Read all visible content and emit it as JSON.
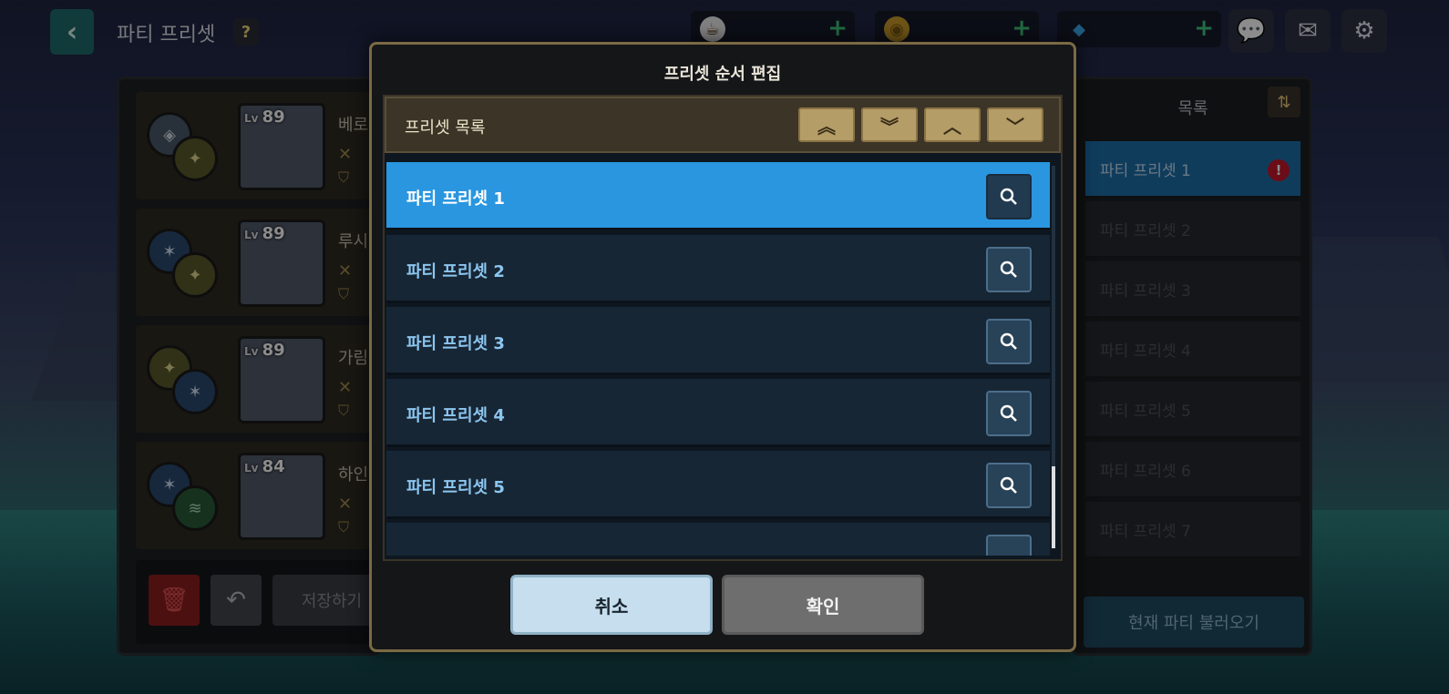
{
  "header": {
    "title": "파티 프리셋",
    "help_label": "?"
  },
  "currencies": [
    {
      "icon": "coffee-icon",
      "value": ""
    },
    {
      "icon": "gold-coin-icon",
      "value": ""
    },
    {
      "icon": "diamond-icon",
      "value": ""
    }
  ],
  "top_icons": [
    "chat-icon",
    "mail-icon",
    "gear-icon"
  ],
  "party": {
    "members": [
      {
        "level": "89",
        "name": "베로"
      },
      {
        "level": "89",
        "name": "루시"
      },
      {
        "level": "89",
        "name": "가림"
      },
      {
        "level": "84",
        "name": "하인"
      }
    ],
    "save_label": "저장하기"
  },
  "modal": {
    "title": "프리셋 순서 편집",
    "list_header": "프리셋 목록",
    "rows": [
      {
        "label": "파티 프리셋 1",
        "selected": true
      },
      {
        "label": "파티 프리셋 2",
        "selected": false
      },
      {
        "label": "파티 프리셋 3",
        "selected": false
      },
      {
        "label": "파티 프리셋 4",
        "selected": false
      },
      {
        "label": "파티 프리셋 5",
        "selected": false
      }
    ],
    "cancel_label": "취소",
    "confirm_label": "확인"
  },
  "preset_list": {
    "title": "목록",
    "items": [
      "파티 프리셋 1",
      "파티 프리셋 2",
      "파티 프리셋 3",
      "파티 프리셋 4",
      "파티 프리셋 5",
      "파티 프리셋 6",
      "파티 프리셋 7"
    ],
    "load_label": "현재 파티 불러오기"
  },
  "colors": {
    "selected_row": "#2a96e0",
    "modal_border": "#7a6a44",
    "move_button": "#b59d68",
    "warning": "#c4172a"
  }
}
